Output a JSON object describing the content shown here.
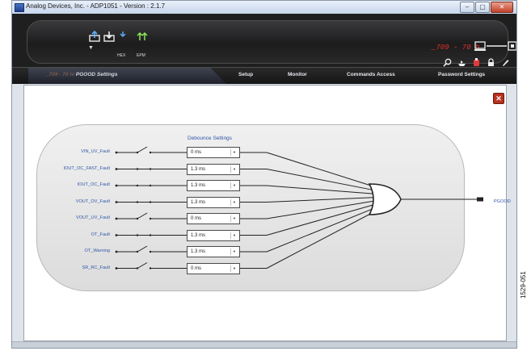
{
  "window": {
    "title": "Analog Devices, Inc. - ADP1051 - Version : 2.1.7"
  },
  "toolbar": {
    "icon_hex_label": "HEX",
    "icon_epm_label": "EPM",
    "device_display": "_709 - 70 h"
  },
  "nav": {
    "breadcrumb_prefix": "_709 - 70 h/",
    "breadcrumb_current": "PGOOD Settings",
    "items": [
      "Setup",
      "Monitor",
      "Commands Access",
      "Password Settings"
    ]
  },
  "diagram": {
    "debounce_title": "Debounce Settings",
    "output_label": "PGOOD",
    "signals": [
      {
        "label": "VIN_UV_Fault",
        "debounce": "0 ms",
        "switch_open": true
      },
      {
        "label": "IOUT_OC_FAST_Fault",
        "debounce": "1.3 ms",
        "switch_open": false
      },
      {
        "label": "IOUT_OC_Fault",
        "debounce": "1.3 ms",
        "switch_open": false
      },
      {
        "label": "VOUT_OV_Fault",
        "debounce": "1.3 ms",
        "switch_open": false
      },
      {
        "label": "VOUT_UV_Fault",
        "debounce": "0 ms",
        "switch_open": true
      },
      {
        "label": "OT_Fault",
        "debounce": "1.3 ms",
        "switch_open": false
      },
      {
        "label": "OT_Warning",
        "debounce": "1.3 ms",
        "switch_open": true
      },
      {
        "label": "SR_RC_Fault",
        "debounce": "0 ms",
        "switch_open": true
      }
    ]
  },
  "figure_id": "1529-051"
}
